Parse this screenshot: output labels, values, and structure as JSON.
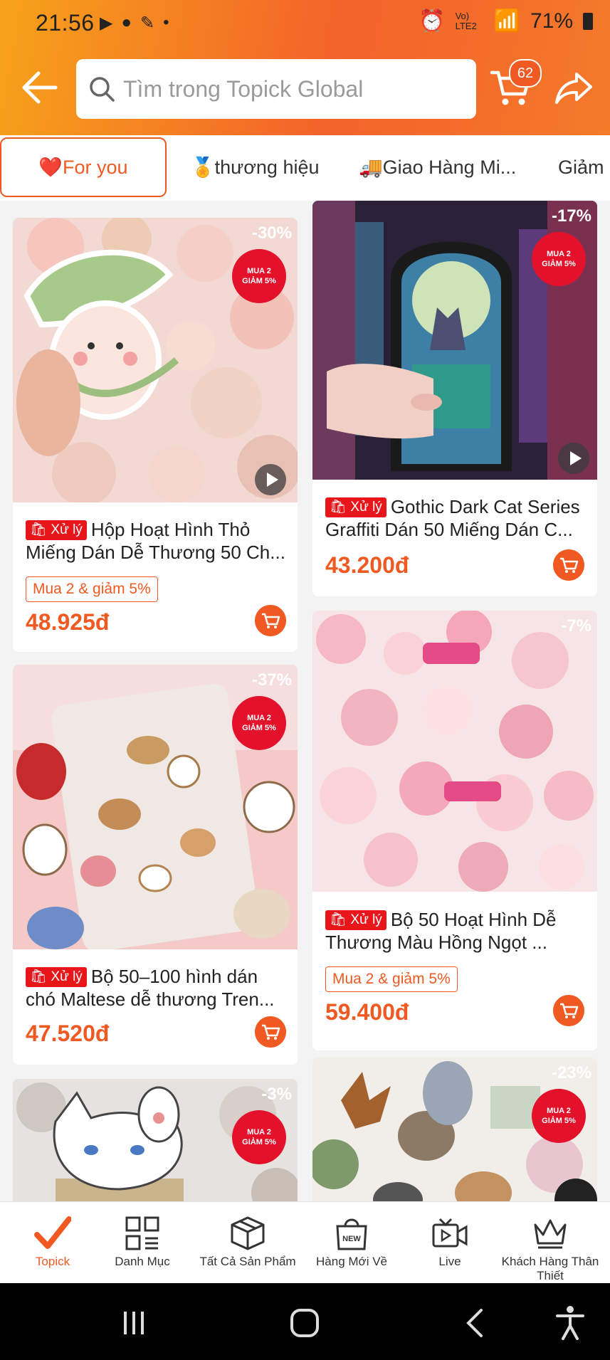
{
  "status": {
    "time": "21:56",
    "network": "Vo) LTE2",
    "battery": "71%"
  },
  "search": {
    "placeholder": "Tìm trong Topick Global",
    "cart_count": "62"
  },
  "tabs": [
    {
      "label": "❤️For you"
    },
    {
      "label": "🏅thương hiệu"
    },
    {
      "label": "🚚Giao Hàng Mi..."
    },
    {
      "label": "Giảm G"
    }
  ],
  "badge_label": "Xử lý",
  "promo_circle": {
    "line1": "MUA 2",
    "line2": "GIẢM 5%"
  },
  "products": [
    {
      "discount": "-30%",
      "title": "Hộp Hoạt Hình Thỏ Miếng Dán Dễ Thương 50 Ch...",
      "promo": "Mua 2 & giảm 5%",
      "price": "48.925đ"
    },
    {
      "discount": "-17%",
      "title": "Gothic Dark Cat Series Graffiti Dán 50 Miếng Dán C...",
      "promo": "",
      "price": "43.200đ"
    },
    {
      "discount": "-37%",
      "title": "Bộ 50–100 hình dán chó Maltese dễ thương Tren...",
      "promo": "",
      "price": "47.520đ"
    },
    {
      "discount": "-7%",
      "title": "Bộ 50 Hoạt Hình Dễ Thương Màu Hồng Ngọt ...",
      "promo": "Mua 2 & giảm 5%",
      "price": "59.400đ"
    },
    {
      "discount": "-3%",
      "title": "",
      "promo": "",
      "price": ""
    },
    {
      "discount": "-23%",
      "title": "",
      "promo": "",
      "price": ""
    }
  ],
  "nav": [
    {
      "label": "Topick",
      "icon": "check-icon"
    },
    {
      "label": "Danh Mục",
      "icon": "grid-icon"
    },
    {
      "label": "Tất Cả Sản Phẩm",
      "icon": "box-icon"
    },
    {
      "label": "Hàng Mới Về",
      "icon": "new-bag-icon"
    },
    {
      "label": "Live",
      "icon": "live-tv-icon"
    },
    {
      "label": "Khách Hàng Thân Thiết",
      "icon": "crown-icon"
    }
  ],
  "colors": {
    "accent": "#f05a22",
    "badge_red": "#e8151b",
    "header_orange": "#f3622a"
  }
}
